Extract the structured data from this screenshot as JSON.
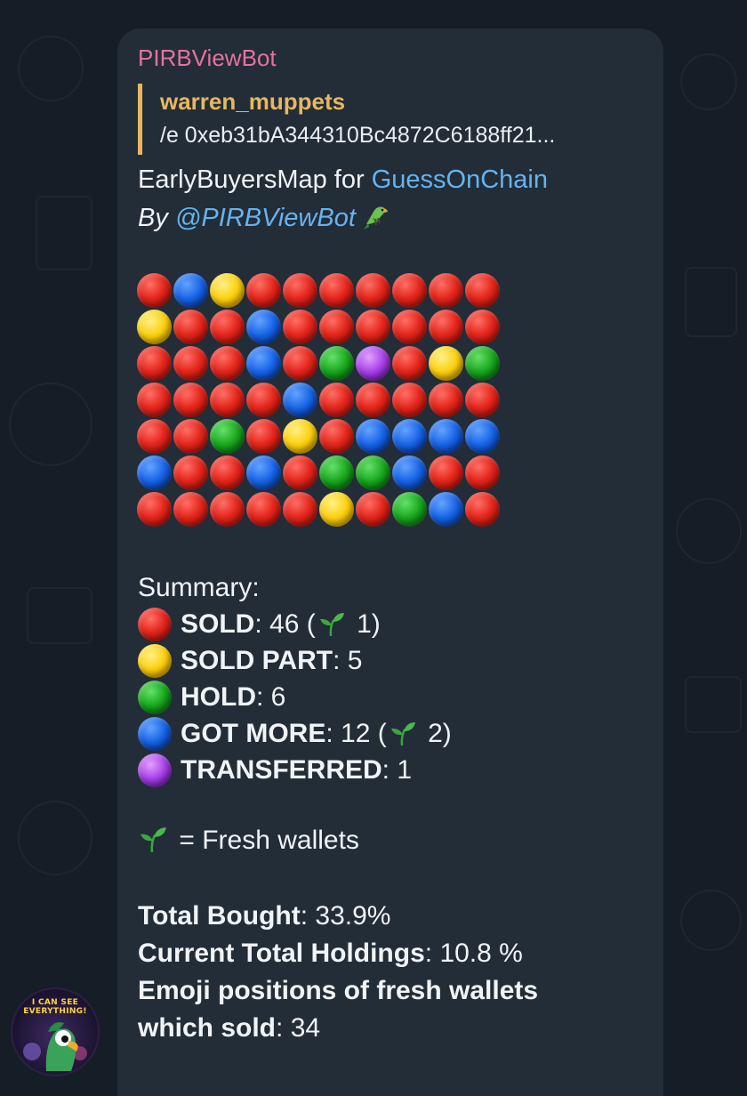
{
  "message": {
    "sender": "PIRBViewBot",
    "reply": {
      "user": "warren_muppets",
      "text": "/e 0xeb31bA344310Bc4872C6188ff21..."
    },
    "title_prefix": "EarlyBuyersMap for ",
    "title_link": "GuessOnChain",
    "byline_prefix": "By ",
    "byline_link": "@PIRBViewBot",
    "map_rows": [
      [
        "red",
        "blue",
        "yellow",
        "red",
        "red",
        "red",
        "red",
        "red",
        "red",
        "red"
      ],
      [
        "yellow",
        "red",
        "red",
        "blue",
        "red",
        "red",
        "red",
        "red",
        "red",
        "red"
      ],
      [
        "red",
        "red",
        "red",
        "blue",
        "red",
        "green",
        "purple",
        "red",
        "yellow",
        "green"
      ],
      [
        "red",
        "red",
        "red",
        "red",
        "blue",
        "red",
        "red",
        "red",
        "red",
        "red"
      ],
      [
        "red",
        "red",
        "green",
        "red",
        "yellow",
        "red",
        "blue",
        "blue",
        "blue",
        "blue"
      ],
      [
        "blue",
        "red",
        "red",
        "blue",
        "red",
        "green",
        "green",
        "blue",
        "red",
        "red"
      ],
      [
        "red",
        "red",
        "red",
        "red",
        "red",
        "yellow",
        "red",
        "green",
        "blue",
        "red"
      ]
    ],
    "summary": {
      "heading": "Summary:",
      "items": [
        {
          "color": "red",
          "label": "SOLD",
          "value": "46",
          "fresh": "1"
        },
        {
          "color": "yellow",
          "label": "SOLD PART",
          "value": "5",
          "fresh": ""
        },
        {
          "color": "green",
          "label": "HOLD",
          "value": "6",
          "fresh": ""
        },
        {
          "color": "blue",
          "label": "GOT MORE",
          "value": "12",
          "fresh": "2"
        },
        {
          "color": "purple",
          "label": "TRANSFERRED",
          "value": "1",
          "fresh": ""
        }
      ]
    },
    "fresh_legend": "= Fresh wallets",
    "stats": {
      "total_bought_label": "Total Bought",
      "total_bought_value": "33.9%",
      "holdings_label": "Current Total Holdings",
      "holdings_value": "10.8 %",
      "fresh_positions_label_1": "Emoji positions of fresh wallets",
      "fresh_positions_label_2": "which sold",
      "fresh_positions_value": "34"
    }
  },
  "avatar": {
    "text_line1": "I CAN SEE",
    "text_line2": "EVERYTHING!"
  },
  "colors": {
    "background": "#151d26",
    "bubble": "#222d38",
    "sender": "#e5739a",
    "reply_accent": "#e7b760",
    "link": "#66b3ee"
  },
  "icons": {
    "bot": "parrot-icon",
    "fresh": "seedling-icon"
  }
}
